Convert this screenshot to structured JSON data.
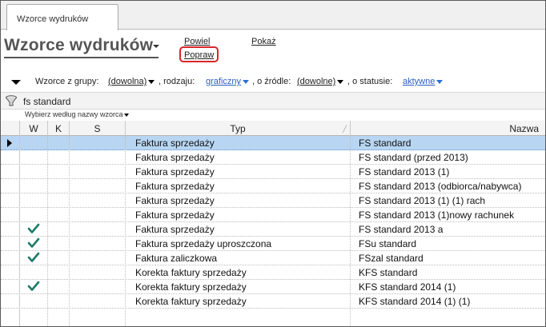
{
  "tab": {
    "label": "Wzorce wydruków"
  },
  "header": {
    "title": "Wzorce wydruków"
  },
  "actions": {
    "powiel": "Powiel",
    "popraw": "Popraw",
    "pokaz": "Pokaż"
  },
  "filters": {
    "group_label": "Wzorce z grupy:",
    "group_value": "(dowolna)",
    "kind_label": ", rodzaju:",
    "kind_value": "graficzny",
    "source_label": ", o źródle:",
    "source_value": "(dowolne)",
    "status_label": ", o statusie:",
    "status_value": "aktywne"
  },
  "search": {
    "value": "fs standard",
    "sort_label": "Wybierz według nazwy wzorca"
  },
  "table": {
    "columns": [
      "W",
      "K",
      "S",
      "Typ",
      "Nazwa"
    ],
    "rows": [
      {
        "typ": "Faktura sprzedaży",
        "nazwa": "FS standard",
        "w": false,
        "selected": true
      },
      {
        "typ": "Faktura sprzedaży",
        "nazwa": "FS standard (przed 2013)",
        "w": false
      },
      {
        "typ": "Faktura sprzedaży",
        "nazwa": "FS standard 2013 (1)",
        "w": false
      },
      {
        "typ": "Faktura sprzedaży",
        "nazwa": "FS standard 2013 (odbiorca/nabywca)",
        "w": false
      },
      {
        "typ": "Faktura sprzedaży",
        "nazwa": "FS standard 2013 (1) (1) rach",
        "w": false
      },
      {
        "typ": "Faktura sprzedaży",
        "nazwa": "FS standard 2013 (1)nowy rachunek",
        "w": false
      },
      {
        "typ": "Faktura sprzedaży",
        "nazwa": "FS standard 2013 a",
        "w": true
      },
      {
        "typ": "Faktura sprzedaży uproszczona",
        "nazwa": "FSu standard",
        "w": true
      },
      {
        "typ": "Faktura zaliczkowa",
        "nazwa": "FSzal standard",
        "w": true
      },
      {
        "typ": "Korekta faktury sprzedaży",
        "nazwa": "KFS standard",
        "w": false
      },
      {
        "typ": "Korekta faktury sprzedaży",
        "nazwa": "KFS standard 2014 (1)",
        "w": true
      },
      {
        "typ": "Korekta faktury sprzedaży",
        "nazwa": "KFS standard 2014 (1) (1)",
        "w": false
      }
    ]
  },
  "colors": {
    "selection": "#b8d6f2",
    "check": "#1f7a6a",
    "link": "#2a5fc0",
    "highlight": "#d9262b"
  },
  "icons": {
    "filter": "funnel-icon",
    "check": "check-icon",
    "row_indicator": "row-pointer-icon"
  }
}
